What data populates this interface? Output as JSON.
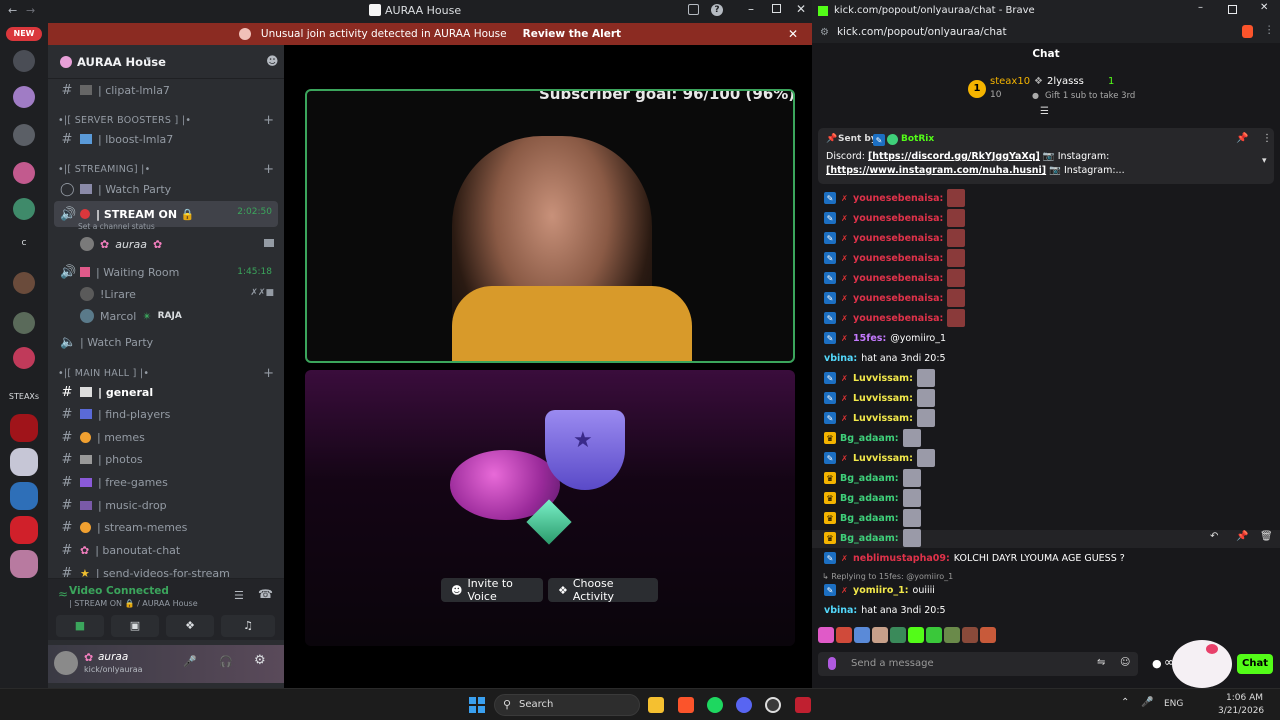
{
  "discord": {
    "window_title": "AURAA House",
    "new_badge": "NEW",
    "banner": {
      "text": "Unusual join activity detected in AURAA House",
      "action": "Review the Alert"
    },
    "server_name": "AURAA House",
    "steaxs_label": "STEAXs",
    "server_letter": "c",
    "channels": [
      {
        "type": "text",
        "label": "| clipat-lmla7"
      },
      {
        "type": "category",
        "label": "•|[ SERVER BOOSTERS ] |•"
      },
      {
        "type": "text",
        "label": "| lboost-lmla7"
      },
      {
        "type": "category",
        "label": "•|[ STREAMING] |•"
      },
      {
        "type": "voice",
        "label": "| Watch Party"
      },
      {
        "type": "voice",
        "label": "| STREAM ON 🔒",
        "timer": "2:02:50",
        "status": "Set a channel status"
      },
      {
        "type": "user",
        "label": "auraa"
      },
      {
        "type": "voice",
        "label": "| Waiting Room",
        "timer": "1:45:18"
      },
      {
        "type": "user",
        "label": "!Lirare"
      },
      {
        "type": "user",
        "label": "Marcol",
        "tag": "RAJA"
      },
      {
        "type": "voice",
        "label": "| Watch Party"
      },
      {
        "type": "category",
        "label": "•|[ MAIN HALL ] |•"
      },
      {
        "type": "text",
        "label": "| general"
      },
      {
        "type": "text",
        "label": "| find-players"
      },
      {
        "type": "text",
        "label": "| memes"
      },
      {
        "type": "text",
        "label": "| photos"
      },
      {
        "type": "text",
        "label": "| free-games"
      },
      {
        "type": "text",
        "label": "| music-drop"
      },
      {
        "type": "text",
        "label": "| stream-memes"
      },
      {
        "type": "text",
        "label": "| banoutat-chat"
      },
      {
        "type": "text",
        "label": "| send-videos-for-stream"
      }
    ],
    "voice_panel": {
      "status": "Video Connected",
      "location": "| STREAM ON 🔒 / AURAA House"
    },
    "user_panel": {
      "name": "auraa",
      "status": "kick/onlyauraa"
    },
    "stage": {
      "overlay": "Subscriber goal: 96/100 (96%)",
      "invite_label": "Invite to Voice",
      "activity_label": "Choose Activity"
    }
  },
  "brave": {
    "title": "kick.com/popout/onlyauraa/chat - Brave",
    "url": "kick.com/popout/onlyauraa/chat",
    "chat_header": "Chat",
    "leaderboard": {
      "rank": "1",
      "first_name": "steax10",
      "first_count": "10",
      "second_name": "2lyasss",
      "second_count": "1",
      "gift_text": "Gift 1 sub to take 3rd"
    },
    "pinned": {
      "sent_by": "Sent by",
      "bot": "BotRix",
      "line1_prefix": "Discord: ",
      "line1_link": "[https://discord.gg/RkYJggYaXq]",
      "line1_suffix": " 📷 Instagram:",
      "line2_link": "[https://www.instagram.com/nuha.husni]",
      "line2_suffix": " 📷 Instagram:..."
    },
    "messages": [
      {
        "user": "younesebenaisa:",
        "text": "",
        "color": "#e0324a",
        "badge": "kick"
      },
      {
        "user": "younesebenaisa:",
        "text": "",
        "color": "#e0324a",
        "badge": "kick"
      },
      {
        "user": "younesebenaisa:",
        "text": "",
        "color": "#e0324a",
        "badge": "kick"
      },
      {
        "user": "younesebenaisa:",
        "text": "",
        "color": "#e0324a",
        "badge": "kick"
      },
      {
        "user": "younesebenaisa:",
        "text": "",
        "color": "#e0324a",
        "badge": "kick"
      },
      {
        "user": "younesebenaisa:",
        "text": "",
        "color": "#e0324a",
        "badge": "kick"
      },
      {
        "user": "younesebenaisa:",
        "text": "",
        "color": "#e0324a",
        "badge": "kick"
      },
      {
        "user": "15fes:",
        "text": "@yomiiro_1",
        "color": "#c57aff",
        "badge": "kick"
      },
      {
        "user": "vbina:",
        "text": "hat ana 3ndi 20:5",
        "color": "#53d8fb",
        "badge": ""
      },
      {
        "user": "Luvvissam:",
        "text": "",
        "color": "#f3e94b",
        "badge": "kick"
      },
      {
        "user": "Luvvissam:",
        "text": "",
        "color": "#f3e94b",
        "badge": "kick"
      },
      {
        "user": "Luvvissam:",
        "text": "",
        "color": "#f3e94b",
        "badge": "kick"
      },
      {
        "user": "Bg_adaam:",
        "text": "",
        "color": "#3fd07a",
        "badge": "crown"
      },
      {
        "user": "Luvvissam:",
        "text": "",
        "color": "#f3e94b",
        "badge": "kick"
      },
      {
        "user": "Bg_adaam:",
        "text": "",
        "color": "#3fd07a",
        "badge": "crown"
      },
      {
        "user": "Bg_adaam:",
        "text": "",
        "color": "#3fd07a",
        "badge": "crown"
      },
      {
        "user": "Bg_adaam:",
        "text": "",
        "color": "#3fd07a",
        "badge": "crown"
      },
      {
        "user": "Bg_adaam:",
        "text": "",
        "color": "#3fd07a",
        "badge": "crown"
      },
      {
        "user": "neblimustapha09:",
        "text": "KOLCHI DAYR LYOUMA AGE GUESS ?",
        "color": "#e0324a",
        "badge": "kick"
      }
    ],
    "reply_ref": "Replying to 15fes: @yomiiro_1",
    "reply_msg": {
      "user": "yomiiro_1:",
      "text": "ouiiii",
      "color": "#f3e94b"
    },
    "last_msg": {
      "user": "vbina:",
      "text": "hat ana 3ndi 20:5",
      "color": "#53d8fb"
    },
    "input_placeholder": "Send a message",
    "chat_button": "Chat",
    "infinity": "∞"
  },
  "taskbar": {
    "search": "Search",
    "lang": "ENG",
    "time": "1:06 AM",
    "date": "3/21/2026"
  }
}
